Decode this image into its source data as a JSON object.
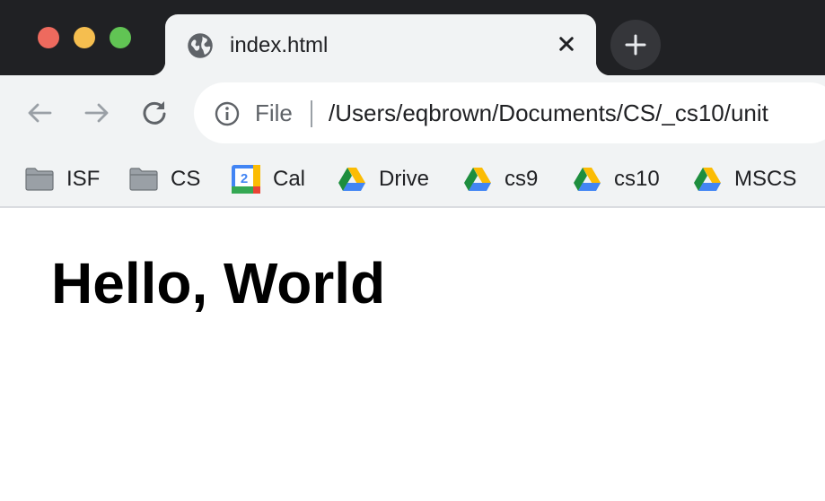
{
  "window": {
    "traffic_lights": {
      "close": "#ee6a5e",
      "minimize": "#f5be4f",
      "maximize": "#61c454"
    }
  },
  "tab": {
    "title": "index.html",
    "icon": "globe-icon",
    "close_icon": "close-icon"
  },
  "new_tab": {
    "icon": "plus-icon"
  },
  "toolbar": {
    "back_icon": "arrow-left-icon",
    "forward_icon": "arrow-right-icon",
    "reload_icon": "reload-icon"
  },
  "omnibox": {
    "info_icon": "info-icon",
    "scheme_label": "File",
    "url": "/Users/eqbrown/Documents/CS/_cs10/unit"
  },
  "bookmarks": [
    {
      "label": "ISF",
      "icon": "folder-icon"
    },
    {
      "label": "CS",
      "icon": "folder-icon"
    },
    {
      "label": "Cal",
      "icon": "google-calendar-icon",
      "icon_text": "2"
    },
    {
      "label": "Drive",
      "icon": "google-drive-icon"
    },
    {
      "label": "cs9",
      "icon": "google-drive-icon"
    },
    {
      "label": "cs10",
      "icon": "google-drive-icon"
    },
    {
      "label": "MSCS",
      "icon": "google-drive-icon"
    }
  ],
  "page": {
    "heading": "Hello, World"
  },
  "colors": {
    "titlebar": "#202124",
    "toolbar": "#f1f3f4",
    "tab": "#f1f3f4",
    "drive_green": "#1e8e3e",
    "drive_blue": "#4285f4",
    "drive_yellow": "#fbbc04"
  }
}
